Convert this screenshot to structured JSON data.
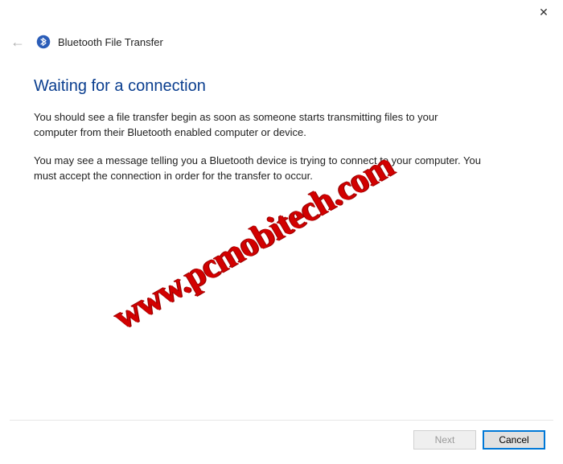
{
  "titlebar": {
    "close_label": "✕"
  },
  "header": {
    "back_label": "←",
    "title": "Bluetooth File Transfer"
  },
  "main": {
    "heading": "Waiting for a connection",
    "paragraph1": "You should see a file transfer begin as soon as someone starts transmitting files to your computer from their Bluetooth enabled computer or device.",
    "paragraph2": "You may see a message telling you a Bluetooth device is trying to connect to your computer. You must accept the connection in order for the transfer to occur."
  },
  "buttons": {
    "next_label": "Next",
    "cancel_label": "Cancel"
  },
  "watermark": {
    "text": "www.pcmobitech.com"
  }
}
